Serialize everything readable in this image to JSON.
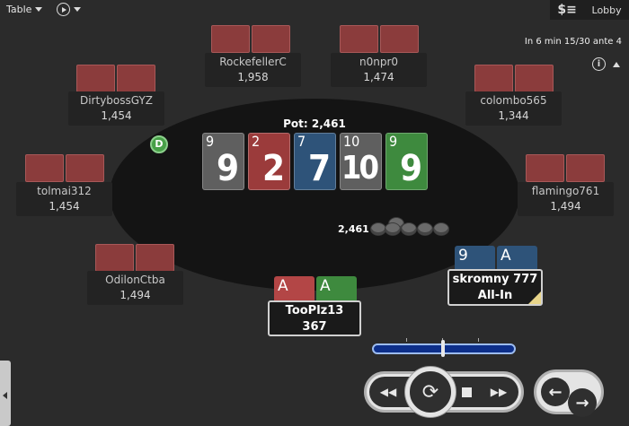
{
  "topbar": {
    "table_label": "Table",
    "lobby_label": "Lobby",
    "dollar_icon": "dollar-list-icon",
    "tournament_info": "In 6 min 15/30 ante 4"
  },
  "pot": {
    "label": "Pot: 2,461"
  },
  "board": [
    {
      "rank": "9",
      "color": "#5f5f5f"
    },
    {
      "rank": "2",
      "color": "#9b3b3b"
    },
    {
      "rank": "7",
      "color": "#2e5379"
    },
    {
      "rank": "10",
      "color": "#5f5f5f"
    },
    {
      "rank": "9",
      "color": "#3e8a3e"
    }
  ],
  "players": {
    "rockefeller": {
      "name": "RockefellerC",
      "stack": "1,958"
    },
    "n0npr0": {
      "name": "n0npr0",
      "stack": "1,474"
    },
    "dirtyboss": {
      "name": "DirtybossGYZ",
      "stack": "1,454"
    },
    "colombo": {
      "name": "colombo565",
      "stack": "1,344"
    },
    "tolmai": {
      "name": "tolmai312",
      "stack": "1,454"
    },
    "flamingo": {
      "name": "flamingo761",
      "stack": "1,494"
    },
    "odilon": {
      "name": "OdilonCtba",
      "stack": "1,494"
    }
  },
  "hero": {
    "name": "TooPlz13",
    "stack": "367",
    "cards": [
      {
        "rank": "A",
        "color": "#b34646"
      },
      {
        "rank": "A",
        "color": "#3e8a3e"
      }
    ]
  },
  "allin_player": {
    "name": "skromny 777",
    "status": "All-In",
    "cards": [
      {
        "rank": "9",
        "color": "#2e5379"
      },
      {
        "rank": "A",
        "color": "#2e5379"
      }
    ]
  },
  "dealer_label": "D",
  "bet": {
    "amount": "2,461"
  },
  "replay": {
    "slider_position": 0.5
  }
}
